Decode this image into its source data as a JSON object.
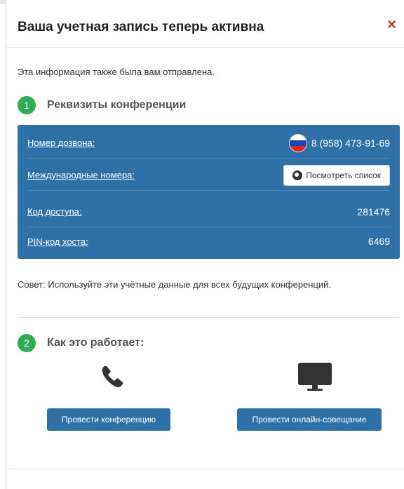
{
  "dialog": {
    "title": "Ваша учетная запись теперь активна",
    "close_label": "×"
  },
  "info_text": "Эта информация также была вам отправлена.",
  "steps": [
    {
      "num": "1",
      "label": "Реквизиты конференции"
    },
    {
      "num": "2",
      "label": "Как это работает:"
    }
  ],
  "details": {
    "dial_label": "Номер дозвона:",
    "dial_value": "8 (958) 473-91-69",
    "intl_label": "Международные номера:",
    "intl_button": "Посмотреть список",
    "access_label": "Код доступа:",
    "access_value": "281476",
    "pin_label": "PIN-код хоста:",
    "pin_value": "6469"
  },
  "tip": "Совет: Используйте эти учётные данные для всех будущих конференций.",
  "actions": {
    "conference_button": "Провести конференцию",
    "meeting_button": "Провести онлайн-совещание"
  },
  "icons": {
    "flag": "russia-flag-icon",
    "globe": "globe-icon",
    "phone": "phone-icon",
    "monitor": "monitor-icon"
  },
  "colors": {
    "panel": "#2f70a6",
    "step_badge": "#2eac57",
    "close": "#c9302c"
  }
}
